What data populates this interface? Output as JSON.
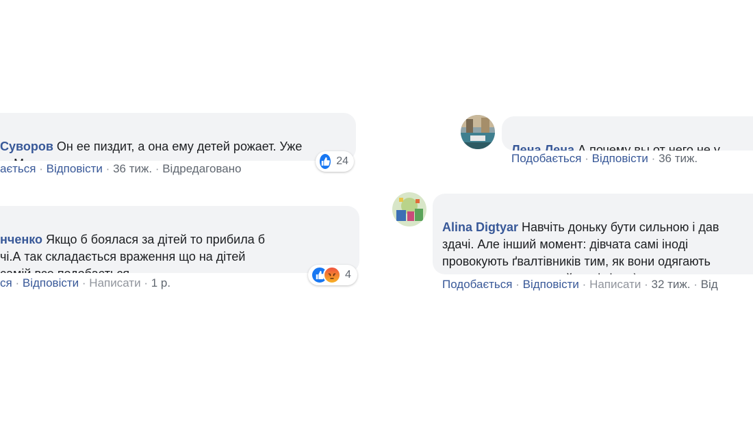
{
  "comments": [
    {
      "author": "Суворов",
      "text": "Он ее пиздит, а она ему детей рожает. Уже\nо. Мозгов совсем нет.",
      "like_label": "ається",
      "reply_label": "Відповісти",
      "time": "36 тиж.",
      "edited": "Відредаговано",
      "reaction_count": "24",
      "reaction_icons": [
        "like-icon"
      ]
    },
    {
      "author": "нченко",
      "text": "Якщо б боялася за дітей то прибила б\nчі.А так складається враження що на дітей\nсамій все подобається",
      "like_label": "ся",
      "reply_label": "Відповісти",
      "write_label": "Написати",
      "time": "1 р.",
      "reaction_count": "4",
      "reaction_icons": [
        "like-icon",
        "angry-icon"
      ]
    },
    {
      "author": "Лена Лена",
      "text": "А почему вы от него не у",
      "like_label": "Подобається",
      "reply_label": "Відповісти",
      "time": "36 тиж."
    },
    {
      "author": "Alina Digtyar",
      "text": "Навчіть доньку бути сильною і дав\nздачі. Але інший момент: дівчата самі іноді\nпровокують ґвалтівників тим, як вони одягають\nшорти-труси, оголений живіт і т.п.)",
      "like_label": "Подобається",
      "reply_label": "Відповісти",
      "write_label": "Написати",
      "time": "32 тиж.",
      "extra_label": "Від"
    }
  ],
  "colors": {
    "author": "#385898",
    "bubble": "#f2f3f5",
    "like": "#1877f2",
    "meta": "#606770"
  }
}
